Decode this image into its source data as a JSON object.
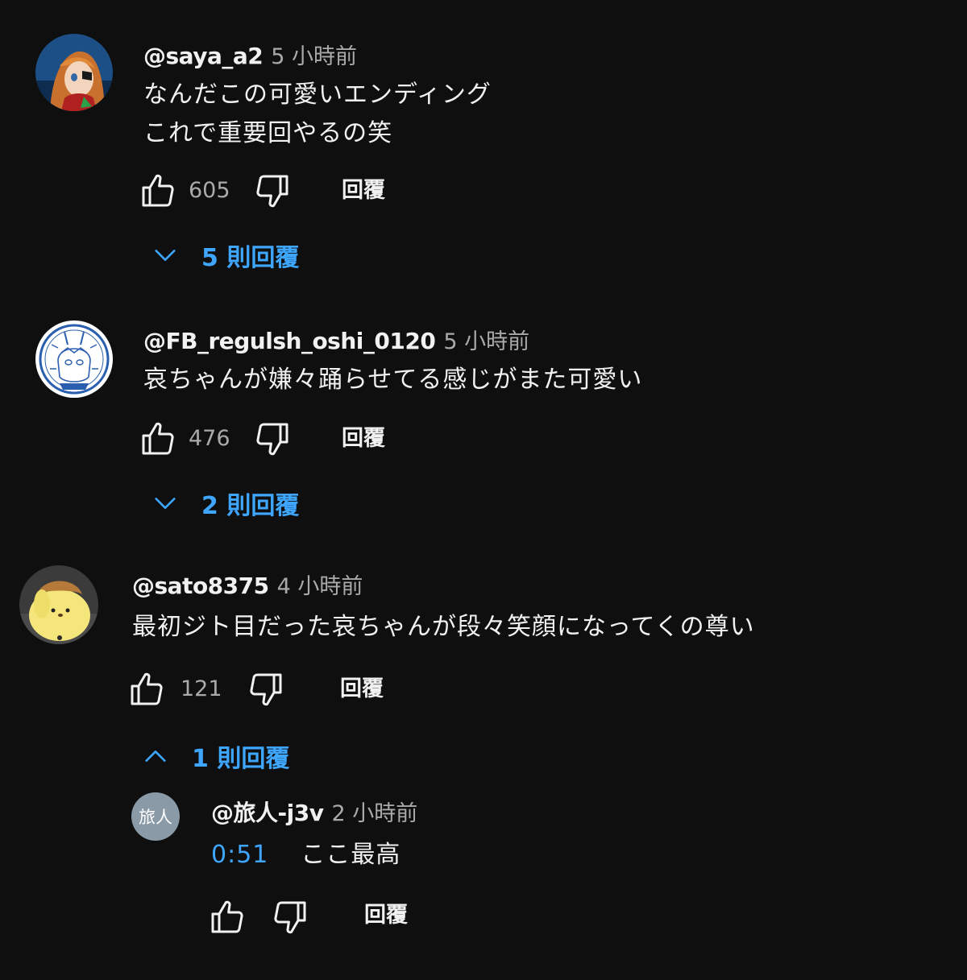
{
  "comments": [
    {
      "author": "@saya_a2",
      "time": "5 小時前",
      "lines": [
        "なんだこの可愛いエンディング",
        "これで重要回やるの笑"
      ],
      "likes": "605",
      "reply_label": "回覆",
      "replies_toggle": "5 則回覆"
    },
    {
      "author": "@FB_regulsh_oshi_0120",
      "time": "5 小時前",
      "lines": [
        "哀ちゃんが嫌々踊らせてる感じがまた可愛い"
      ],
      "likes": "476",
      "reply_label": "回覆",
      "replies_toggle": "2 則回覆"
    },
    {
      "author": "@sato8375",
      "time": "4 小時前",
      "lines": [
        "最初ジト目だった哀ちゃんが段々笑顔になってくの尊い"
      ],
      "likes": "121",
      "reply_label": "回覆",
      "replies_toggle": "1 則回覆"
    }
  ],
  "reply": {
    "avatar_text": "旅人",
    "author": "@旅人-j3v",
    "time": "2 小時前",
    "timestamp_link": "0:51",
    "text": "ここ最高",
    "reply_label": "回覆"
  },
  "colors": {
    "background": "#0f0f0f",
    "link_blue": "#3ea6ff",
    "secondary_text": "#aaaaaa"
  }
}
